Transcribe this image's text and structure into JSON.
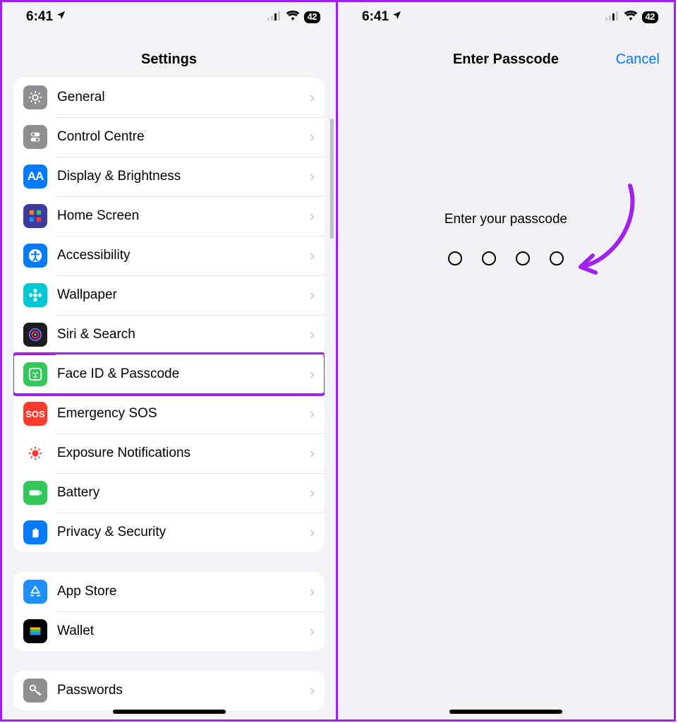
{
  "status": {
    "time": "6:41",
    "battery": "42"
  },
  "left": {
    "title": "Settings",
    "groups": [
      [
        {
          "id": "general",
          "label": "General",
          "bg": "#8e8e93",
          "icon": "gear"
        },
        {
          "id": "control-centre",
          "label": "Control Centre",
          "bg": "#8e8e93",
          "icon": "sliders"
        },
        {
          "id": "display-brightness",
          "label": "Display & Brightness",
          "bg": "#007aff",
          "icon": "aa"
        },
        {
          "id": "home-screen",
          "label": "Home Screen",
          "bg": "#3a3a9f",
          "icon": "grid"
        },
        {
          "id": "accessibility",
          "label": "Accessibility",
          "bg": "#007aff",
          "icon": "accessibility"
        },
        {
          "id": "wallpaper",
          "label": "Wallpaper",
          "bg": "#00c7d4",
          "icon": "flower"
        },
        {
          "id": "siri-search",
          "label": "Siri & Search",
          "bg": "#1c1c1e",
          "icon": "siri"
        },
        {
          "id": "face-id-passcode",
          "label": "Face ID & Passcode",
          "bg": "#34c759",
          "icon": "faceid",
          "highlight": true
        },
        {
          "id": "emergency-sos",
          "label": "Emergency SOS",
          "bg": "#ff3b30",
          "icon": "sos"
        },
        {
          "id": "exposure",
          "label": "Exposure Notifications",
          "bg": "#ffffff",
          "icon": "exposure"
        },
        {
          "id": "battery",
          "label": "Battery",
          "bg": "#34c759",
          "icon": "battery"
        },
        {
          "id": "privacy-security",
          "label": "Privacy & Security",
          "bg": "#007aff",
          "icon": "hand"
        }
      ],
      [
        {
          "id": "app-store",
          "label": "App Store",
          "bg": "#1f8fff",
          "icon": "appstore"
        },
        {
          "id": "wallet",
          "label": "Wallet",
          "bg": "#000000",
          "icon": "wallet"
        }
      ],
      [
        {
          "id": "passwords",
          "label": "Passwords",
          "bg": "#8e8e93",
          "icon": "key"
        }
      ]
    ]
  },
  "right": {
    "title": "Enter Passcode",
    "cancel": "Cancel",
    "prompt": "Enter your passcode",
    "dot_count": 4
  },
  "annotations": {
    "highlight_row": "face-id-passcode",
    "arrow_color": "#a020f0"
  }
}
